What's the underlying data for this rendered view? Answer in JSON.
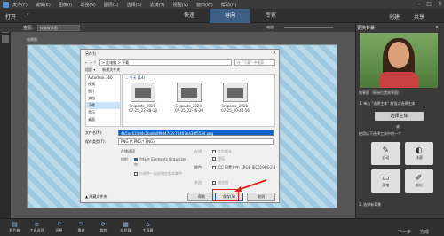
{
  "menubar": {
    "items": [
      "文件(F)",
      "编辑(E)",
      "图像(I)",
      "增强(N)",
      "图层(L)",
      "选择(S)",
      "滤镜(T)",
      "视图(V)",
      "窗口(W)",
      "帮助(H)"
    ],
    "window_controls": [
      "–",
      "□",
      "✕"
    ]
  },
  "topbar": {
    "open_label": "打开",
    "modes": [
      "快速",
      "导向",
      "专家"
    ],
    "active_mode": "导向",
    "create_label": "创建",
    "share_label": "共享"
  },
  "toolrow": {
    "view_label": "查看:",
    "view_value": "仅限效果图",
    "zoom_label": "缩放:"
  },
  "canvas": {
    "image_title": "效果图"
  },
  "right_panel": {
    "title": "更换背景",
    "close": "✕",
    "scene_label": "效果图（原始位置效果图）",
    "step1": "1. 单击 \"选择主体\" 按钮以选择主体",
    "select_subject_btn": "选择主体",
    "or_text": "或",
    "step_hint": "使用以下选择工具中的一个",
    "tools": [
      {
        "name": "自动",
        "glyph": "✎",
        "icon": "auto-select-icon"
      },
      {
        "name": "快速",
        "glyph": "◐",
        "icon": "quick-select-icon"
      },
      {
        "name": "画笔",
        "glyph": "▭",
        "icon": "brush-icon"
      },
      {
        "name": "细化",
        "glyph": "✐",
        "icon": "refine-icon"
      }
    ],
    "step2": "2. 选择新背景"
  },
  "dialog": {
    "title": "另存为",
    "close": "✕",
    "nav_back": "←  →  ↑",
    "path": "> 此电脑 > 下载",
    "search_placeholder": "在 \"下载\" 中搜索",
    "toolbar": [
      "组织 ▾",
      "新建文件夹"
    ],
    "nav_items": [
      "Autodesk 360",
      "视频",
      "图片",
      "文档",
      "下载",
      "音乐",
      "桌面"
    ],
    "nav_selected": "下载",
    "group_label": "⌄ 今天 (14)",
    "files": [
      "Snipaste_2020-07-25_22-38-18",
      "Snipaste_2020-07-25_22-36-20",
      "Snipaste_2020-07-25_20-44-56"
    ],
    "filename_label": "文件名(N):",
    "filename_value": "4b5a4633d4c2ba8a8f9d47c2c71407ea3df5534.png",
    "filetype_label": "保存类型(T):",
    "filetype_value": "PNG (*.PNG;*.PNG)",
    "options_title": "存储选项",
    "organize_label": "组织:",
    "include_elements": "包括在 Elements Organizer 中",
    "save_with_original": "与原件一起存储在版本集中",
    "save_label": "存储:",
    "as_copy": "作为副本",
    "layers": "图层",
    "color_label": "颜色:",
    "icc": "ICC 配置文件: sRGB IEC61966-2.1",
    "other_label": "其他:",
    "thumbnail": "缩览图",
    "hide_folders": "▲ 隐藏文件夹",
    "btn_help": "帮助",
    "btn_save": "保存(S)",
    "btn_cancel": "取消"
  },
  "bottombar": {
    "items": [
      {
        "label": "照片箱",
        "glyph": "▤",
        "icon": "photo-bin-icon"
      },
      {
        "label": "工具选项",
        "glyph": "≡",
        "icon": "tool-options-icon"
      },
      {
        "label": "还原",
        "glyph": "↶",
        "icon": "undo-icon"
      },
      {
        "label": "重做",
        "glyph": "↷",
        "icon": "redo-icon"
      },
      {
        "label": "旋转",
        "glyph": "⟳",
        "icon": "rotate-icon"
      },
      {
        "label": "组织器",
        "glyph": "▦",
        "icon": "organizer-icon"
      },
      {
        "label": "主屏幕",
        "glyph": "⌂",
        "icon": "home-icon"
      }
    ],
    "next_label": "下一步",
    "done_label": "完成"
  },
  "colors": {
    "accent": "#3d5f85",
    "highlight": "#0a64c8",
    "annotation": "#e02020"
  }
}
